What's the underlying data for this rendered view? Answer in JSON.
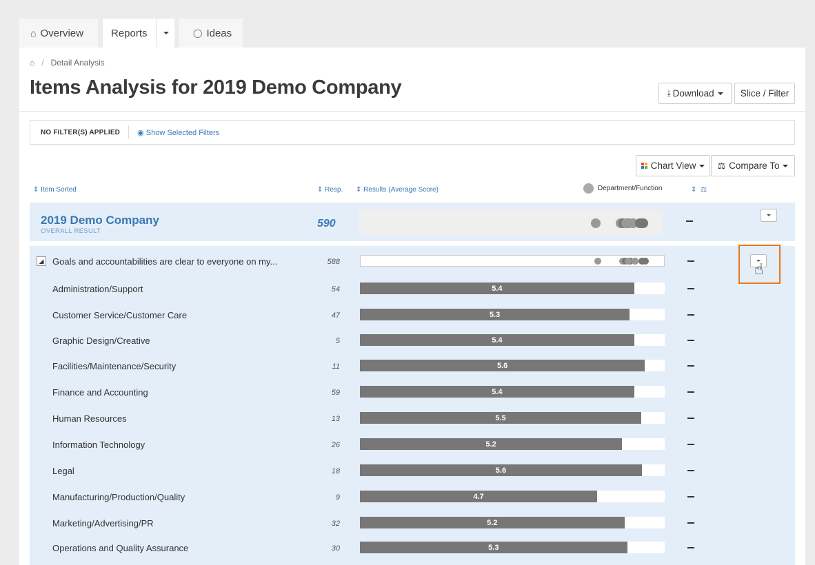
{
  "tabs": [
    {
      "label": "Overview",
      "icon": "home-icon"
    },
    {
      "label": "Reports",
      "icon": ""
    },
    {
      "label": "Ideas",
      "icon": "lightbulb-icon"
    }
  ],
  "breadcrumb": {
    "home_icon": "home-icon",
    "current": "Detail Analysis"
  },
  "page_title": "Items Analysis for 2019 Demo Company",
  "toolbar": {
    "download_label": "Download",
    "slice_filter_label": "Slice / Filter"
  },
  "filters": {
    "status": "NO FILTER(S) APPLIED",
    "show_selected": "Show Selected Filters"
  },
  "view_controls": {
    "chart_view_label": "Chart View",
    "compare_to_label": "Compare To"
  },
  "columns": {
    "item": "Item Sorted",
    "resp": "Resp.",
    "results": "Results (Average Score)",
    "legend": "Department/Function"
  },
  "overall": {
    "name": "2019 Demo Company",
    "subtitle": "OVERALL RESULT",
    "count": "590"
  },
  "item": {
    "label": "Goals and accountabilities are clear to everyone on my...",
    "count": "588"
  },
  "departments": [
    {
      "label": "Administration/Support",
      "resp": "54",
      "score": "5.4",
      "fill": 0.9
    },
    {
      "label": "Customer Service/Customer Care",
      "resp": "47",
      "score": "5.3",
      "fill": 0.885
    },
    {
      "label": "Graphic Design/Creative",
      "resp": "5",
      "score": "5.4",
      "fill": 0.9
    },
    {
      "label": "Facilities/Maintenance/Security",
      "resp": "11",
      "score": "5.6",
      "fill": 0.935
    },
    {
      "label": "Finance and Accounting",
      "resp": "59",
      "score": "5.4",
      "fill": 0.9
    },
    {
      "label": "Human Resources",
      "resp": "13",
      "score": "5.5",
      "fill": 0.923
    },
    {
      "label": "Information Technology",
      "resp": "26",
      "score": "5.2",
      "fill": 0.86
    },
    {
      "label": "Legal",
      "resp": "18",
      "score": "5.6",
      "fill": 0.925
    },
    {
      "label": "Manufacturing/Production/Quality",
      "resp": "9",
      "score": "4.7",
      "fill": 0.779
    },
    {
      "label": "Marketing/Advertising/PR",
      "resp": "32",
      "score": "5.2",
      "fill": 0.868
    },
    {
      "label": "Operations and Quality Assurance",
      "resp": "30",
      "score": "5.3",
      "fill": 0.877
    }
  ],
  "colors": {
    "accent": "#3a78b5",
    "row_bg": "#e3eef8",
    "bar": "#777777",
    "highlight": "#e87722"
  }
}
